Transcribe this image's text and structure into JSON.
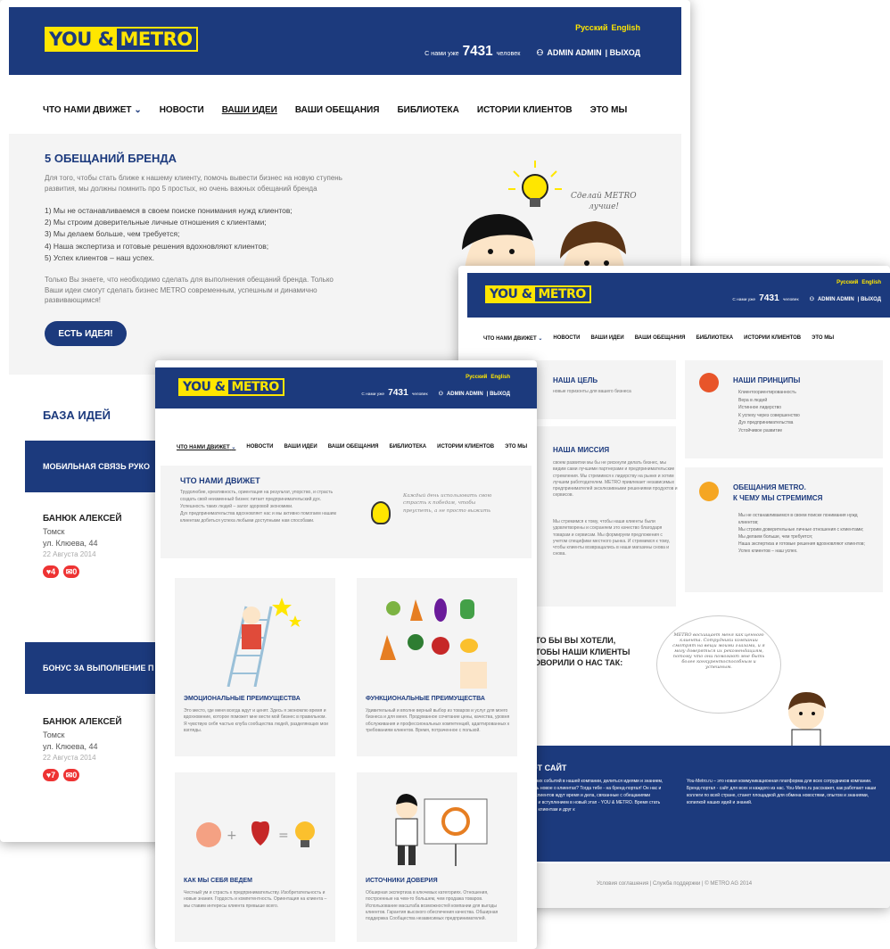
{
  "colors": {
    "brand_blue": "#1c3a7d",
    "brand_yellow": "#ffe600",
    "badge_red": "#e33333"
  },
  "brand": {
    "logo_left": "YOU &",
    "logo_right": "METRO"
  },
  "lang": {
    "ru": "Русский",
    "en": "English"
  },
  "user": {
    "prefix": "С нами уже",
    "count": "7431",
    "suffix": "человек",
    "name": "ADMIN ADMIN",
    "logout": "| ВЫХОД"
  },
  "nav": [
    "ЧТО НАМИ ДВИЖЕТ",
    "НОВОСТИ",
    "ВАШИ ИДЕИ",
    "ВАШИ ОБЕЩАНИЯ",
    "БИБЛИОТЕКА",
    "ИСТОРИИ КЛИЕНТОВ",
    "ЭТО МЫ"
  ],
  "promises": {
    "title": "5 ОБЕЩАНИЙ БРЕНДА",
    "intro": "Для того, чтобы стать ближе к нашему клиенту, помочь вывести бизнес на новую ступень развития, мы должны помнить про 5 простых, но очень важных обещаний бренда",
    "items": [
      "1) Мы не останавливаемся в своем поиске понимания нужд клиентов;",
      "2) Мы строим доверительные личные отношения с клиентами;",
      "3) Мы делаем больше, чем требуется;",
      "4) Наша экспертиза и готовые решения вдохновляют клиентов;",
      "5) Успех клиентов – наш успех."
    ],
    "outro": "Только Вы знаете, что необходимо сделать для выполнения обещаний бренда. Только Ваши идеи смогут сделать бизнес METRO современным, успешным и динамично развивающимся!",
    "button": "ЕСТЬ ИДЕЯ!",
    "bubble": "Сделай METRO лучше!"
  },
  "ideas": {
    "title": "БАЗА ИДЕЙ",
    "list": [
      {
        "title": "МОБИЛЬНАЯ СВЯЗЬ РУКО",
        "author": "БАНЮК АЛЕКСЕЙ",
        "city": "Томск",
        "street": "ул. Клюева, 44",
        "date": "22 Августа 2014",
        "likes": "4",
        "comments": "0"
      },
      {
        "title": "БОНУС ЗА ВЫПОЛНЕНИЕ П",
        "author": "БАНЮК АЛЕКСЕЙ",
        "city": "Томск",
        "street": "ул. Клюева, 44",
        "date": "22 Августа 2014",
        "likes": "7",
        "comments": "0"
      }
    ]
  },
  "drives": {
    "title": "ЧТО НАМИ ДВИЖЕТ",
    "lines": [
      "Трудолюбие, креативность, ориентация на результат, упорство, и страсть",
      "создать свой неизменный бизнес питает предпринимательский дух.",
      "Успешность таких людей – залог здоровой экономики.",
      "Дух предпринимательства вдохновляет нас и мы активно помогаем нашим",
      "клиентам добиться успеха любыми доступными нам способами."
    ],
    "quote": "Каждый день использовать свою страсть к победам, чтобы преуспеть, а не просто выжить",
    "cards": [
      {
        "title": "ЭМОЦИОНАЛЬНЫЕ ПРЕИМУЩЕСТВА",
        "text": "Это место, где меня всегда ждут и ценят. Здесь я экономлю время и вдохновение, которое поможет мне вести мой бизнес в правильном. Я чувствую себя частью клуба сообщества людей, разделяющих мои взгляды."
      },
      {
        "title": "ФУНКЦИОНАЛЬНЫЕ ПРЕИМУЩЕСТВА",
        "text": "Удивительный и вполне верный выбор из товаров и услуг для моего бизнеса и для меня. Продуманное сочетание цены, качества, уровня обслуживания и профессиональных компетенций, адаптированных к требованиям клиентов. Время, потраченное с пользой."
      },
      {
        "title": "КАК МЫ СЕБЯ ВЕДЕМ",
        "text": "Честный ум и страсть к предпринимательству. Изобретательность и новые знания. Гордость и компетентность. Ориентация на клиента – мы ставим интересы клиента превыше всего."
      },
      {
        "title": "ИСТОЧНИКИ ДОВЕРИЯ",
        "text": "Обширная экспертиза в ключевых категориях. Отношения, построенные на чем-то большем, чем продажа товаров. Использование масштаба возможностей компании для выгоды клиентов. Гарантия высокого обеспечения качества. Обширная поддержка Сообщества независимых предпринимателей."
      }
    ]
  },
  "about": {
    "goal_title": "НАША ЦЕЛЬ",
    "goal_text": "новые горизонты для вашего бизнеса",
    "mission_title": "НАША МИССИЯ",
    "mission_text": "своем развитии мы бы не рискнули делать бизнес, мы видим сами лучшими партнерами и предпринимательские стремления. Мы стремимся к лидерству на рынке и хотим лучшим работодателем. METRO привлекает независимых предпринимателей эксклюзивными решениями продуктов и сервисов.",
    "mission_text2": "Мы стремимся к тому, чтобы наши клиенты были удовлетворены и сохраняем это качество благодаря товарам и сервисам. Мы формируем предложения с учетом специфики местного рынка. И стремимся к тому, чтобы клиенты возвращались в наши магазины снова и снова.",
    "principles_title": "НАШИ ПРИНЦИПЫ",
    "principles": [
      "Клиентоориентированность",
      "Вера в людей",
      "Истинное лидерство",
      "К успеху через совершенство",
      "Дух предпринимательства",
      "Устойчивое развитие"
    ],
    "promises_title1": "ОБЕЩАНИЯ METRO.",
    "promises_title2": "К ЧЕМУ МЫ СТРЕМИМСЯ",
    "promises": [
      "Мы не останавливаемся в своем поиске понимания нужд клиентов;",
      "Мы строим доверительные личные отношения с клиентами;",
      "Мы делаем больше, чем требуется;",
      "Наша экспертиза и готовые решения вдохновляют клиентов;",
      "Успех клиентов – наш успех."
    ],
    "want": [
      "ЧТО БЫ ВЫ ХОТЕЛИ,",
      "ЧТОБЫ НАШИ КЛИЕНТЫ",
      "ГОВОРИЛИ О НАС ТАК:"
    ],
    "speech": "METRO восхищает меня как ценного клиента. Сотрудники компании смотрят на вещи моими глазами, и я могу доверяться их рекомендациям, потому что они помогают мне быть более конкурентоспособным и успешным.",
    "site_title": "ЭТОТ САЙТ",
    "site_left": "последних событий в нашей компании, делиться идеями и знанием, узнавать новое о клиентах? Тогда тебе - на бренд-портал! Он нас и наших клиентов ждут время и дела, связанные с обещаниями METRO и вступлением в новый этап - YOU & METRO. Время стать ближе к клиентам и друг к",
    "site_right": "You-Metro.ru – это новая коммуникационная платформа для всех сотрудников компании. Бренд-портал - сайт для всех и каждого из нас. You-Metro.ru расскажет, как работают наши коллеги по всей стране, станет площадкой для обмена новостями, опытом и знаниями, копилкой наших идей и знаний.",
    "footer": "Условия соглашения | Служба поддержки | © METRO AG 2014"
  }
}
